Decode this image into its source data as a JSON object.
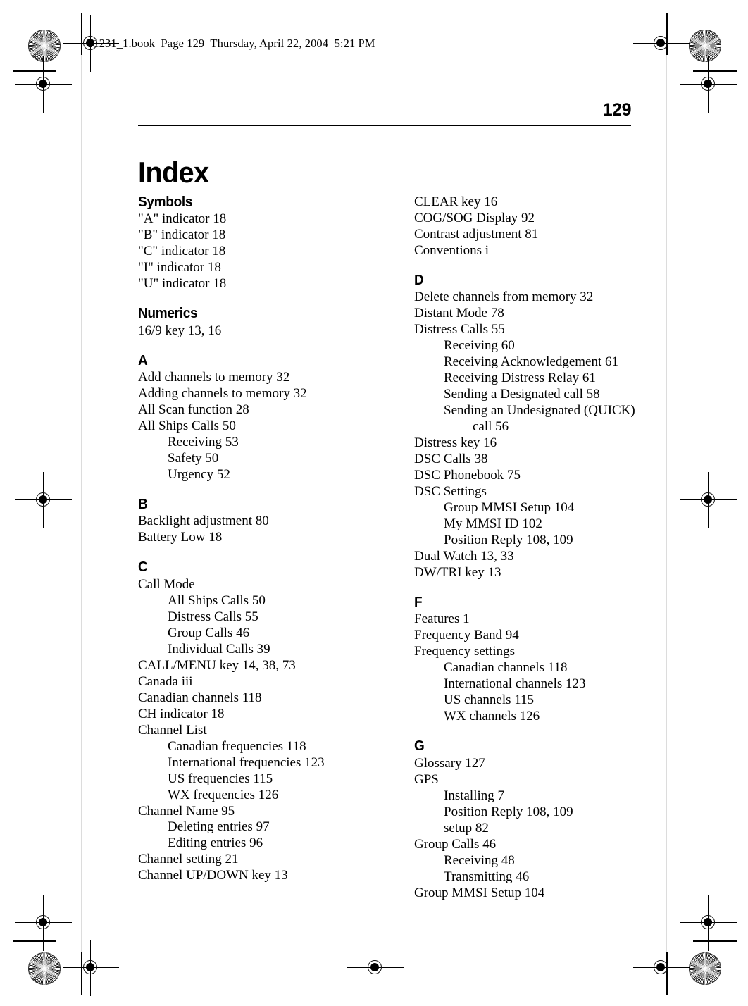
{
  "running_head": "81231_1.book  Page 129  Thursday, April 22, 2004  5:21 PM",
  "page_number": "129",
  "page_title": "Index",
  "columns": [
    {
      "name": "left-column",
      "groups": [
        {
          "letter": "Symbols",
          "entries": [
            {
              "level": 1,
              "text": "\"A\" indicator 18"
            },
            {
              "level": 1,
              "text": "\"B\" indicator 18"
            },
            {
              "level": 1,
              "text": "\"C\" indicator 18"
            },
            {
              "level": 1,
              "text": "\"I\" indicator 18"
            },
            {
              "level": 1,
              "text": "\"U\" indicator 18"
            }
          ]
        },
        {
          "letter": "Numerics",
          "entries": [
            {
              "level": 1,
              "text": "16/9 key 13, 16"
            }
          ]
        },
        {
          "letter": "A",
          "entries": [
            {
              "level": 1,
              "text": "Add channels to memory 32"
            },
            {
              "level": 1,
              "text": "Adding channels to memory 32"
            },
            {
              "level": 1,
              "text": "All Scan function 28"
            },
            {
              "level": 1,
              "text": "All Ships Calls 50"
            },
            {
              "level": 2,
              "text": "Receiving 53"
            },
            {
              "level": 2,
              "text": "Safety 50"
            },
            {
              "level": 2,
              "text": "Urgency 52"
            }
          ]
        },
        {
          "letter": "B",
          "entries": [
            {
              "level": 1,
              "text": "Backlight adjustment 80"
            },
            {
              "level": 1,
              "text": "Battery Low 18"
            }
          ]
        },
        {
          "letter": "C",
          "entries": [
            {
              "level": 1,
              "text": "Call Mode"
            },
            {
              "level": 2,
              "text": "All Ships Calls 50"
            },
            {
              "level": 2,
              "text": "Distress Calls 55"
            },
            {
              "level": 2,
              "text": "Group Calls 46"
            },
            {
              "level": 2,
              "text": "Individual Calls 39"
            },
            {
              "level": 1,
              "text": "CALL/MENU key 14, 38, 73"
            },
            {
              "level": 1,
              "text": "Canada iii"
            },
            {
              "level": 1,
              "text": "Canadian channels 118"
            },
            {
              "level": 1,
              "text": "CH indicator 18"
            },
            {
              "level": 1,
              "text": "Channel List"
            },
            {
              "level": 2,
              "text": "Canadian frequencies 118"
            },
            {
              "level": 2,
              "text": "International frequencies 123"
            },
            {
              "level": 2,
              "text": "US frequencies 115"
            },
            {
              "level": 2,
              "text": "WX frequencies 126"
            },
            {
              "level": 1,
              "text": "Channel Name 95"
            },
            {
              "level": 2,
              "text": "Deleting entries 97"
            },
            {
              "level": 2,
              "text": "Editing entries 96"
            },
            {
              "level": 1,
              "text": "Channel setting 21"
            },
            {
              "level": 1,
              "text": "Channel UP/DOWN key 13"
            }
          ]
        }
      ]
    },
    {
      "name": "right-column",
      "groups": [
        {
          "letter": "",
          "entries": [
            {
              "level": 1,
              "text": "CLEAR key 16"
            },
            {
              "level": 1,
              "text": "COG/SOG Display 92"
            },
            {
              "level": 1,
              "text": "Contrast adjustment 81"
            },
            {
              "level": 1,
              "text": "Conventions i"
            }
          ]
        },
        {
          "letter": "D",
          "entries": [
            {
              "level": 1,
              "text": "Delete channels from memory 32"
            },
            {
              "level": 1,
              "text": "Distant Mode 78"
            },
            {
              "level": 1,
              "text": "Distress Calls 55"
            },
            {
              "level": 2,
              "text": "Receiving 60"
            },
            {
              "level": 2,
              "text": "Receiving Acknowledgement 61"
            },
            {
              "level": 2,
              "text": "Receiving Distress Relay 61"
            },
            {
              "level": 2,
              "text": "Sending a Designated call 58"
            },
            {
              "level": 2,
              "text": "Sending an Undesignated (QUICK)"
            },
            {
              "level": 3,
              "text": "call 56"
            },
            {
              "level": 1,
              "text": "Distress key 16"
            },
            {
              "level": 1,
              "text": "DSC Calls 38"
            },
            {
              "level": 1,
              "text": "DSC Phonebook 75"
            },
            {
              "level": 1,
              "text": "DSC Settings"
            },
            {
              "level": 2,
              "text": "Group MMSI Setup 104"
            },
            {
              "level": 2,
              "text": "My MMSI ID 102"
            },
            {
              "level": 2,
              "text": "Position Reply 108, 109"
            },
            {
              "level": 1,
              "text": "Dual Watch 13, 33"
            },
            {
              "level": 1,
              "text": "DW/TRI key 13"
            }
          ]
        },
        {
          "letter": "F",
          "entries": [
            {
              "level": 1,
              "text": "Features 1"
            },
            {
              "level": 1,
              "text": "Frequency Band 94"
            },
            {
              "level": 1,
              "text": "Frequency settings"
            },
            {
              "level": 2,
              "text": "Canadian channels 118"
            },
            {
              "level": 2,
              "text": "International channels 123"
            },
            {
              "level": 2,
              "text": "US channels 115"
            },
            {
              "level": 2,
              "text": "WX channels 126"
            }
          ]
        },
        {
          "letter": "G",
          "entries": [
            {
              "level": 1,
              "text": "Glossary 127"
            },
            {
              "level": 1,
              "text": "GPS"
            },
            {
              "level": 2,
              "text": "Installing 7"
            },
            {
              "level": 2,
              "text": "Position Reply 108, 109"
            },
            {
              "level": 2,
              "text": "setup 82"
            },
            {
              "level": 1,
              "text": "Group Calls 46"
            },
            {
              "level": 2,
              "text": "Receiving 48"
            },
            {
              "level": 2,
              "text": "Transmitting 46"
            },
            {
              "level": 1,
              "text": "Group MMSI Setup 104"
            }
          ]
        }
      ]
    }
  ]
}
